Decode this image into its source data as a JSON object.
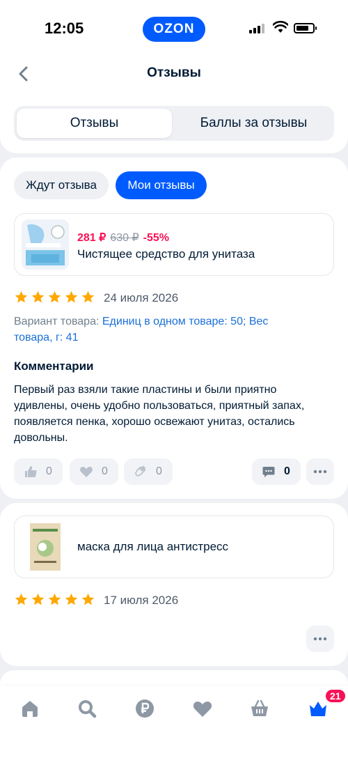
{
  "status_bar": {
    "time": "12:05",
    "brand": "OZON"
  },
  "header": {
    "title": "Отзывы",
    "tabs": [
      {
        "label": "Отзывы",
        "active": true
      },
      {
        "label": "Баллы за отзывы",
        "active": false
      }
    ]
  },
  "filters": {
    "awaiting_label": "Ждут отзыва",
    "mine_label": "Мои отзывы"
  },
  "reviews": [
    {
      "product": {
        "price_now": "281 ₽",
        "price_old": "630 ₽",
        "discount": "-55%",
        "name": "Чистящее средство для унитаза"
      },
      "rating": 5,
      "date": "24 июля 2026",
      "variant_label": "Вариант товара: ",
      "variant_value": "Единиц в одном товаре: 50; Вес товара, г: 41",
      "comments_title": "Комментарии",
      "comment": "Первый раз взяли такие пластины и были приятно удивлены, очень удобно пользоваться, приятный запах, появляется пенка, хорошо освежают унитаз, остались довольны.",
      "reactions": {
        "likes": "0",
        "hearts": "0",
        "claps": "0",
        "comments": "0"
      }
    },
    {
      "product": {
        "name": "маска для лица антистресс"
      },
      "rating": 5,
      "date": "17 июля 2026"
    }
  ],
  "bottom_nav": {
    "items": [
      "home-icon",
      "search-icon",
      "ruble-icon",
      "heart-icon",
      "cart-icon",
      "crown-icon"
    ],
    "badge": "21"
  },
  "colors": {
    "accent": "#005bff",
    "price": "#f91155",
    "star": "#ffa800",
    "link": "#1a6fd8"
  }
}
